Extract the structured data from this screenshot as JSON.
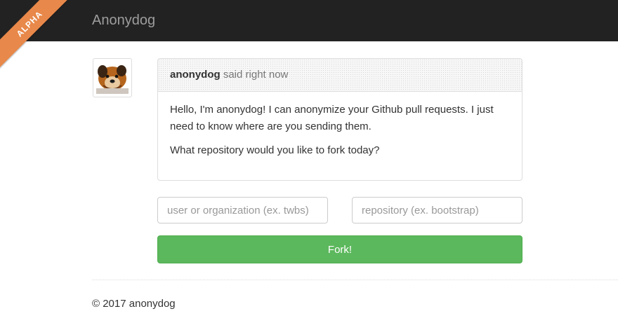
{
  "ribbon": {
    "label": "ALPHA",
    "color": "#e8884a"
  },
  "navbar": {
    "brand": "Anonydog"
  },
  "message": {
    "avatar_icon": "dog-avatar-icon",
    "author": "anonydog",
    "said": "said right now",
    "paragraphs": [
      "Hello, I'm anonydog! I can anonymize your Github pull requests. I just need to know where are you sending them.",
      "What repository would you like to fork today?"
    ]
  },
  "form": {
    "user_placeholder": "user or organization (ex. twbs)",
    "repo_placeholder": "repository (ex. bootstrap)",
    "user_value": "",
    "repo_value": "",
    "fork_label": "Fork!",
    "fork_color": "#5cb85c"
  },
  "footer": {
    "copyright": "© 2017 anonydog"
  }
}
